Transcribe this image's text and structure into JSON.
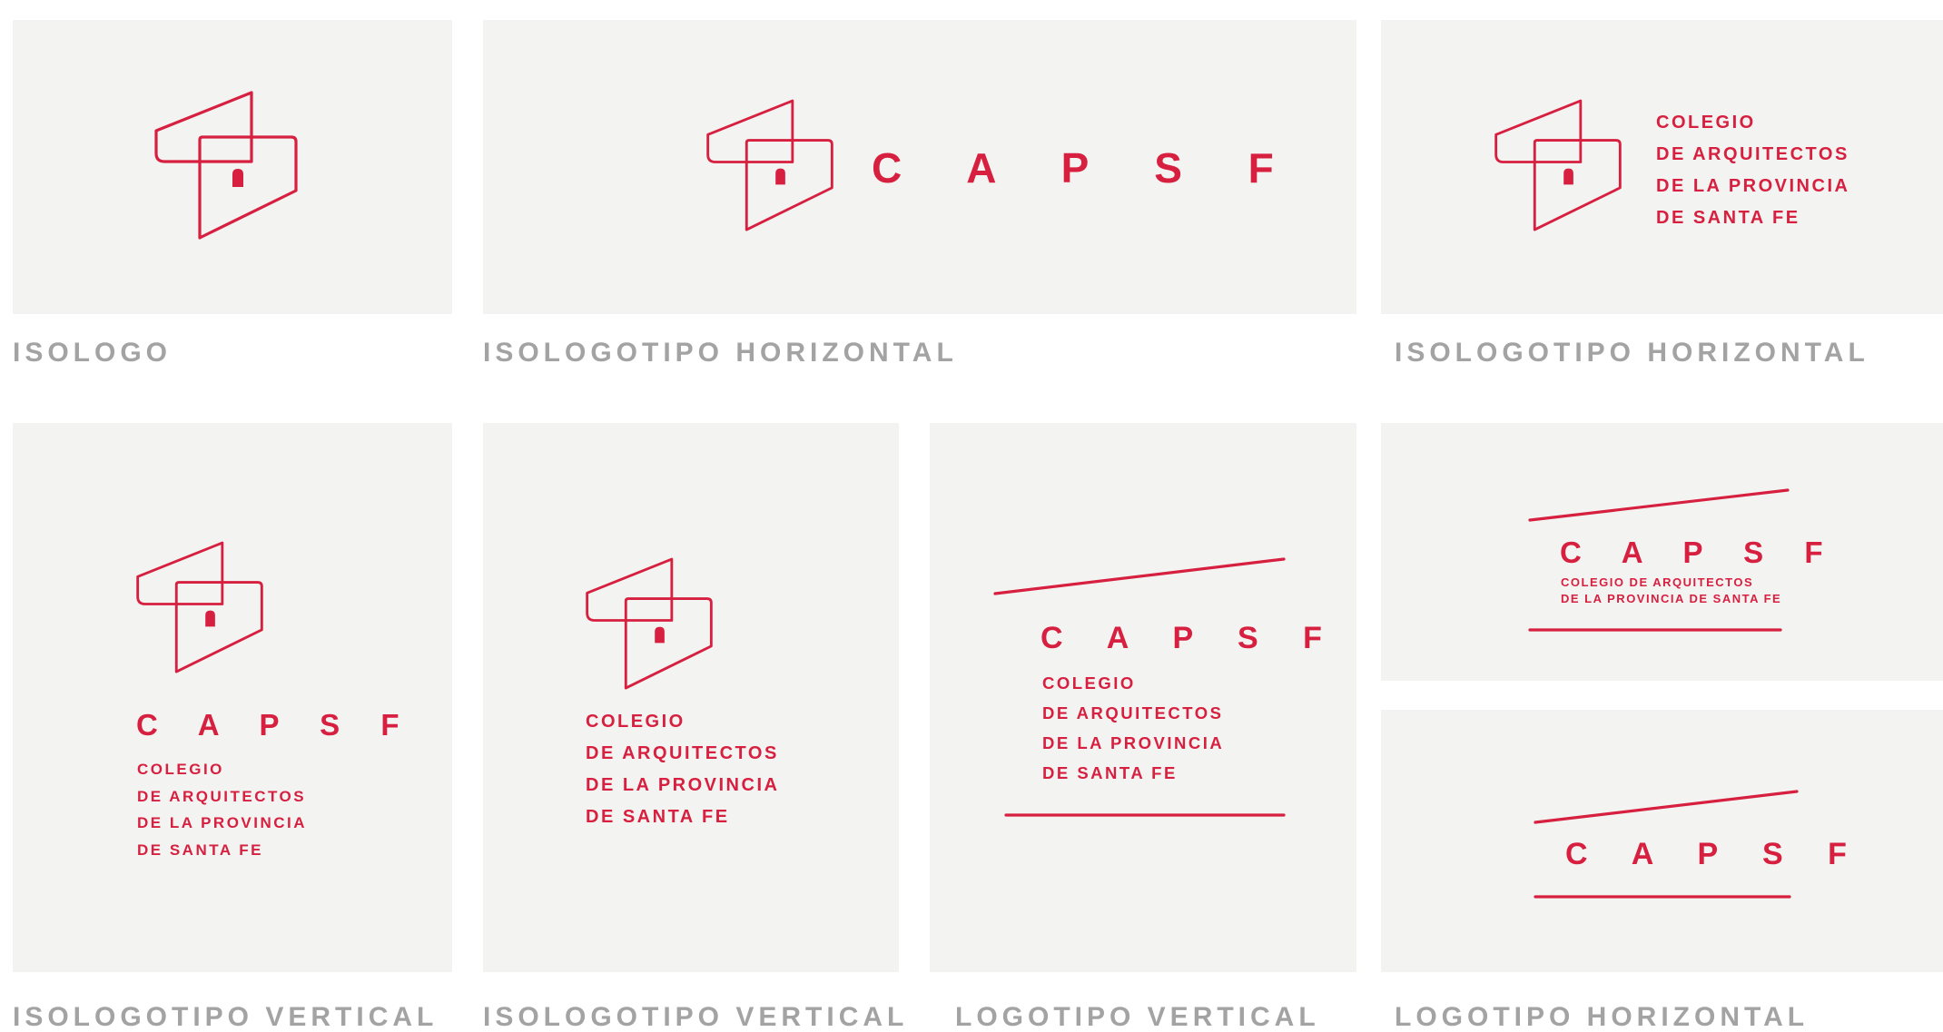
{
  "colors": {
    "brand": "#d71f3f",
    "panel": "#f3f3f2",
    "caption": "#a3a3a3"
  },
  "icon": "capsf-isologo-icon",
  "wordmark": "C A P S F",
  "fullname": [
    "COLEGIO",
    "DE ARQUITECTOS",
    "DE LA PROVINCIA",
    "DE SANTA FE"
  ],
  "fullname_compact": [
    "COLEGIO DE ARQUITECTOS",
    "DE LA PROVINCIA DE SANTA FE"
  ],
  "captions": {
    "isologo": "ISOLOGO",
    "isologotipo_horizontal": "ISOLOGOTIPO HORIZONTAL",
    "isologotipo_vertical": "ISOLOGOTIPO VERTICAL",
    "logotipo_vertical": "LOGOTIPO VERTICAL",
    "logotipo_horizontal": "LOGOTIPO HORIZONTAL"
  }
}
